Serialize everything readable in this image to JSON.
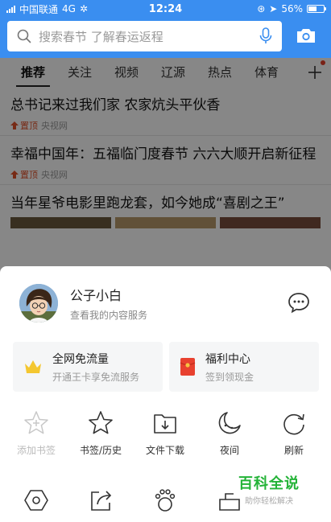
{
  "status_bar": {
    "carrier": "中国联通",
    "network": "4G",
    "time": "12:24",
    "battery": "56%",
    "battery_level": 0.56
  },
  "search": {
    "placeholder": "搜索春节 了解春运返程"
  },
  "tabs": [
    "推荐",
    "关注",
    "视频",
    "辽源",
    "热点",
    "体育"
  ],
  "feed": {
    "items": [
      {
        "title": "总书记来过我们家 农家炕头平伙香",
        "pin": "置顶",
        "source": "央视网"
      },
      {
        "title": "幸福中国年：五福临门度春节 六六大顺开启新征程",
        "pin": "置顶",
        "source": "央视网"
      },
      {
        "title": "当年星爷电影里跑龙套，如今她成“喜剧之王”"
      }
    ]
  },
  "sheet": {
    "user_name": "公子小白",
    "user_sub": "查看我的内容服务",
    "cards": [
      {
        "title": "全网免流量",
        "sub": "开通王卡享免流服务"
      },
      {
        "title": "福利中心",
        "sub": "签到领现金"
      }
    ],
    "tools": [
      {
        "label": "添加书签",
        "icon": "bookmark-add-icon",
        "enabled": false
      },
      {
        "label": "书签/历史",
        "icon": "star-icon",
        "enabled": true
      },
      {
        "label": "文件下载",
        "icon": "download-folder-icon",
        "enabled": true
      },
      {
        "label": "夜间",
        "icon": "moon-icon",
        "enabled": true
      },
      {
        "label": "刷新",
        "icon": "refresh-icon",
        "enabled": true
      }
    ],
    "tools_row2_icons": [
      "settings-hexagon-icon",
      "share-icon",
      "paw-icon",
      "toolbox-icon"
    ]
  },
  "watermark": {
    "main": "百科全说",
    "sub": "助你轻松解决"
  },
  "colors": {
    "brand_blue": "#3a8ef0",
    "pin_red": "#e0512a",
    "accent_green": "#23b337"
  }
}
